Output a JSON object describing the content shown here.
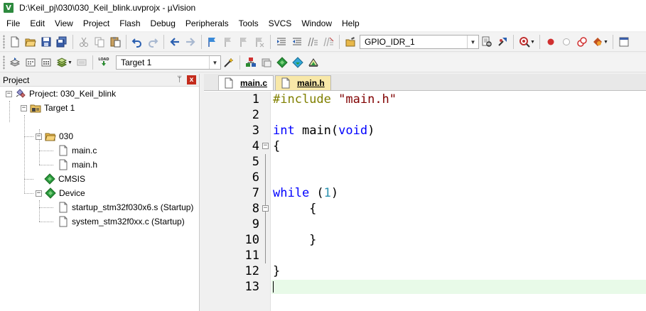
{
  "window": {
    "title": "D:\\Keil_pj\\030\\030_Keil_blink.uvprojx - µVision",
    "app_icon_letter": "V"
  },
  "menu": [
    "File",
    "Edit",
    "View",
    "Project",
    "Flash",
    "Debug",
    "Peripherals",
    "Tools",
    "SVCS",
    "Window",
    "Help"
  ],
  "toolbar1": {
    "find_combo_value": "GPIO_IDR_1"
  },
  "toolbar2": {
    "load_label": "LOAD",
    "target_combo_value": "Target 1"
  },
  "project_pane": {
    "title": "Project",
    "pin": "ᛘ",
    "close": "x",
    "tree": {
      "project": "Project: 030_Keil_blink",
      "target": "Target 1",
      "group_030": "030",
      "file_main_c": "main.c",
      "file_main_h": "main.h",
      "cmsis": "CMSIS",
      "device": "Device",
      "startup_file": "startup_stm32f030x6.s (Startup)",
      "system_file": "system_stm32f0xx.c (Startup)"
    }
  },
  "editor": {
    "tabs": [
      {
        "label": "main.c",
        "active": true
      },
      {
        "label": "main.h",
        "active": false
      }
    ],
    "line_numbers": [
      "1",
      "2",
      "3",
      "4",
      "5",
      "6",
      "7",
      "8",
      "9",
      "10",
      "11",
      "12",
      "13"
    ],
    "code": {
      "l1_directive": "#include",
      "l1_string": "\"main.h\"",
      "l3_type": "int",
      "l3_name": " main(",
      "l3_param": "void",
      "l3_close": ")",
      "l4": "{",
      "l7_kw": "while",
      "l7_open": " (",
      "l7_num": "1",
      "l7_close": ")",
      "l8": "     {",
      "l10": "     }",
      "l12": "}"
    }
  },
  "colors": {
    "keyword": "#0000ff",
    "preprocessor": "#808000",
    "string": "#800000",
    "number": "#2b91af",
    "current_line": "#e8fae8",
    "inactive_tab": "#f8e8a8"
  }
}
